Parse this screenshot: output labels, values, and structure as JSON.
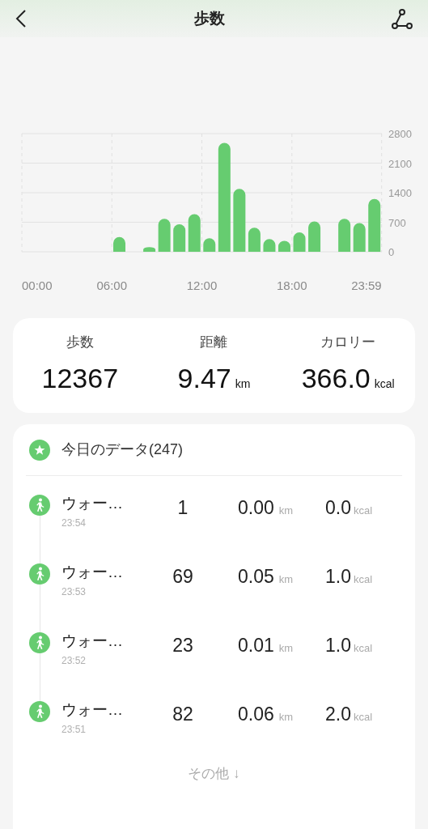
{
  "header": {
    "title": "歩数"
  },
  "chart": {
    "chart_data": {
      "type": "bar",
      "x": [
        6.5,
        8.5,
        9.5,
        10.5,
        11.5,
        12.5,
        13.5,
        14.5,
        15.5,
        16.5,
        17.5,
        18.5,
        19.5,
        21.5,
        22.5,
        23.5
      ],
      "xlim": [
        0,
        24
      ],
      "grid": true,
      "series": [
        {
          "color": "#66cc70",
          "values": [
            350,
            110,
            780,
            650,
            890,
            320,
            2580,
            1490,
            570,
            300,
            260,
            460,
            720,
            780,
            680,
            1250
          ]
        }
      ],
      "ylim": [
        0,
        2800
      ],
      "yticks": [
        0,
        700,
        1400,
        2100,
        2800
      ],
      "xticks": [
        {
          "value": 0,
          "label": "00:00"
        },
        {
          "value": 6,
          "label": "06:00"
        },
        {
          "value": 12,
          "label": "12:00"
        },
        {
          "value": 18,
          "label": "18:00"
        },
        {
          "value": 23.983,
          "label": "23:59"
        }
      ]
    }
  },
  "summary": [
    {
      "label": "歩数",
      "value": "12367"
    },
    {
      "label": "距離",
      "value": "9.47",
      "unit": "km"
    },
    {
      "label": "カロリー",
      "value": "366.0",
      "unit": "kcal"
    }
  ],
  "records": {
    "title": "今日のデータ(247)",
    "items": [
      {
        "name": "ウォー…",
        "time": "23:54",
        "steps": "1",
        "distance": "0.00",
        "distance_unit": "km",
        "calories": "0.0",
        "calories_unit": "kcal"
      },
      {
        "name": "ウォー…",
        "time": "23:53",
        "steps": "69",
        "distance": "0.05",
        "distance_unit": "km",
        "calories": "1.0",
        "calories_unit": "kcal"
      },
      {
        "name": "ウォー…",
        "time": "23:52",
        "steps": "23",
        "distance": "0.01",
        "distance_unit": "km",
        "calories": "1.0",
        "calories_unit": "kcal"
      },
      {
        "name": "ウォー…",
        "time": "23:51",
        "steps": "82",
        "distance": "0.06",
        "distance_unit": "km",
        "calories": "2.0",
        "calories_unit": "kcal"
      }
    ],
    "more": "その他 ↓"
  }
}
